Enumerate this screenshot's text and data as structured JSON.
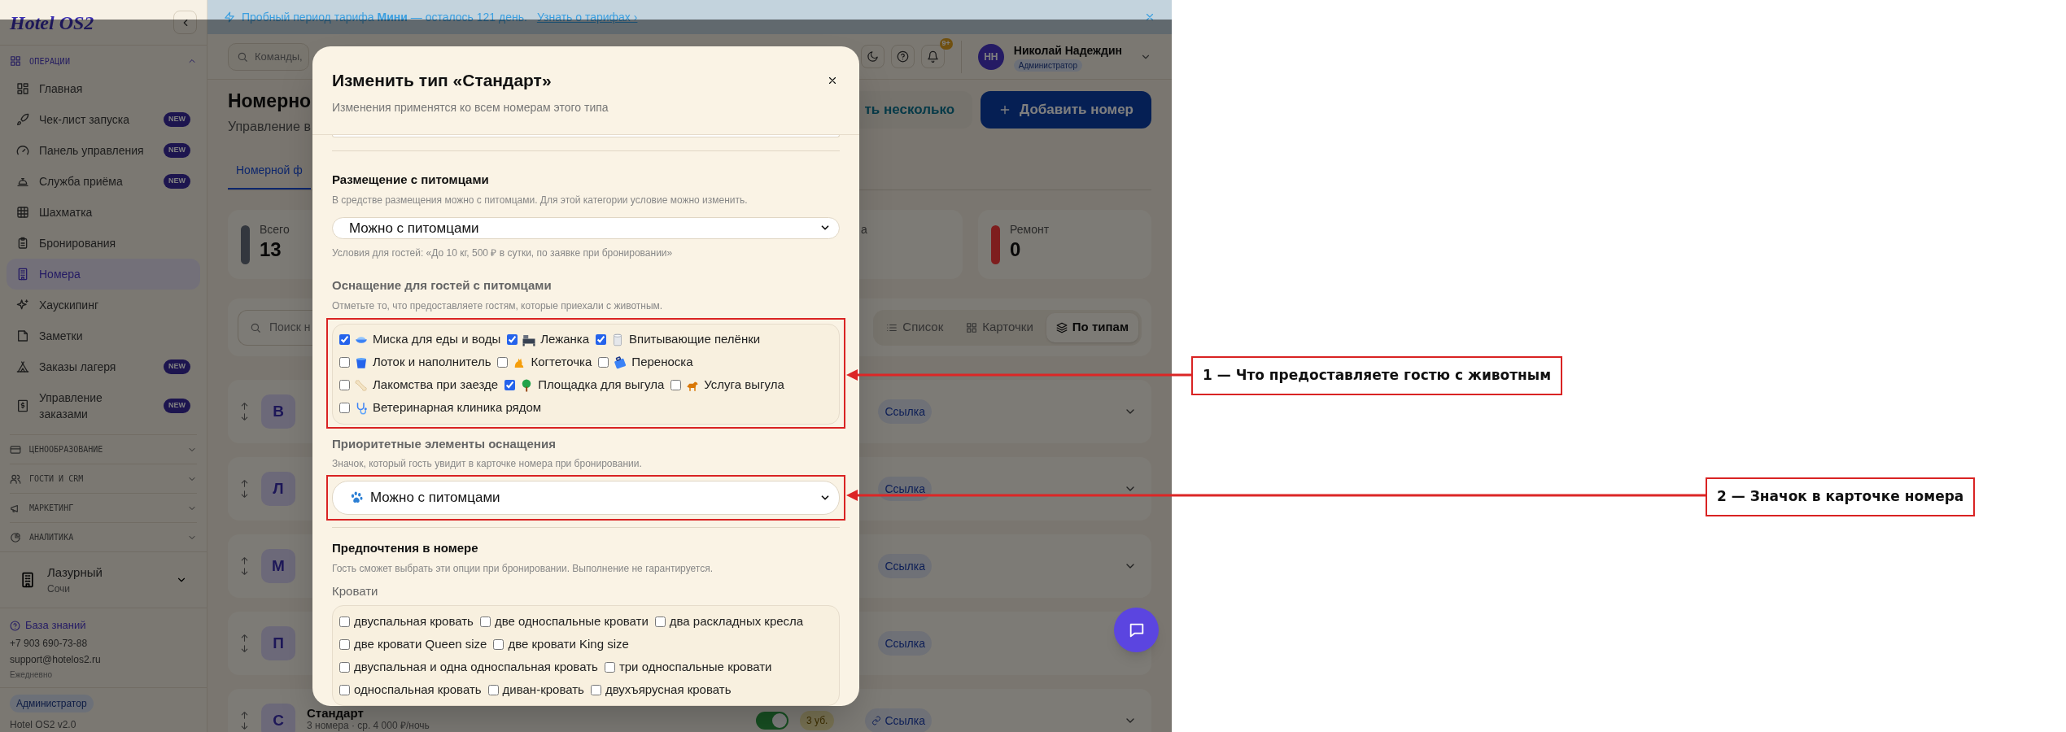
{
  "sidebar": {
    "logo": "Hotel OS2",
    "section": "ОПЕРАЦИИ",
    "items": [
      {
        "label": "Главная",
        "selected": false
      },
      {
        "label": "Чек-лист запуска",
        "badge": "NEW",
        "selected": false
      },
      {
        "label": "Панель управления",
        "badge": "NEW",
        "selected": false
      },
      {
        "label": "Служба приёма",
        "badge": "NEW",
        "selected": false
      },
      {
        "label": "Шахматка",
        "selected": false
      },
      {
        "label": "Бронирования",
        "selected": false
      },
      {
        "label": "Номера",
        "selected": true
      },
      {
        "label": "Хаускипинг",
        "selected": false
      },
      {
        "label": "Заметки",
        "selected": false
      },
      {
        "label": "Заказы лагеря",
        "badge": "NEW",
        "selected": false
      },
      {
        "label": "Управление заказами",
        "badge": "NEW",
        "selected": false
      }
    ],
    "groups": [
      "ЦЕНООБРАЗОВАНИЕ",
      "ГОСТИ И CRM",
      "МАРКЕТИНГ",
      "АНАЛИТИКА"
    ],
    "hotel": {
      "name": "Лазурный",
      "city": "Сочи"
    },
    "support": {
      "link": "База знаний",
      "phone": "+7 903 690-73-88",
      "email": "support@hotelos2.ru",
      "hours": "Ежедневно"
    },
    "role": "Администратор",
    "version": "Hotel OS2 v2.0"
  },
  "banner": {
    "text": "Пробный период тарифа **Мини** — осталось 121 день.",
    "link": "Узнать о тарифах ›"
  },
  "topbar": {
    "search_placeholder": "Команды,",
    "notifications": "9+",
    "user": {
      "initials": "НН",
      "name": "Николай Надеждин",
      "role": "Администратор"
    }
  },
  "page": {
    "title": "Номерно",
    "subtitle": "Управление в",
    "buttons": [
      {
        "label": "ть несколько",
        "kind": "secondary"
      },
      {
        "label": "Добавить номер",
        "kind": "primary"
      }
    ],
    "tabs": [
      {
        "label": "Номерной ф",
        "selected": true
      }
    ],
    "stats": [
      {
        "label": "Всего",
        "value": "13",
        "color": "#33373e"
      },
      {
        "label": "а"
      },
      {
        "label": "Ремонт",
        "value": "0",
        "color": "#7e1e1e"
      }
    ],
    "search_placeholder": "Поиск н",
    "views": [
      {
        "label": "Список",
        "selected": false
      },
      {
        "label": "Карточки",
        "selected": false
      },
      {
        "label": "По типам",
        "selected": true
      }
    ],
    "room_types": [
      {
        "letter": "В",
        "link": "Ссылка"
      },
      {
        "letter": "Л",
        "link": "Ссылка"
      },
      {
        "letter": "М",
        "link": "Ссылка"
      },
      {
        "letter": "П",
        "link": "Ссылка"
      },
      {
        "letter": "С",
        "name": "Стандарт",
        "summary": "3 номера · ср. 4 000 ₽/ночь",
        "on": true,
        "staff": "3 уб.",
        "link": "Ссылка"
      }
    ]
  },
  "modal": {
    "title": "Изменить тип «Стандарт»",
    "subtitle": "Изменения применятся ко всем номерам этого типа",
    "pets": {
      "title": "Размещение с питомцами",
      "hint": "В средстве размещения можно с питомцами. Для этой категории условие можно изменить.",
      "select": "Можно с питомцами",
      "note": "Условия для гостей: «До 10 кг, 500 ₽ в сутки, по заявке при бронировании»"
    },
    "amenities": {
      "title": "Оснащение для гостей с питомцами",
      "hint": "Отметьте то, что предоставляете гостям, которые приехали с животным.",
      "items": [
        {
          "label": "Миска для еды и воды",
          "checked": true
        },
        {
          "label": "Лежанка",
          "checked": true
        },
        {
          "label": "Впитывающие пелёнки",
          "checked": true
        },
        {
          "label": "Лоток и наполнитель",
          "checked": false
        },
        {
          "label": "Когтеточка",
          "checked": false
        },
        {
          "label": "Переноска",
          "checked": false
        },
        {
          "label": "Лакомства при заезде",
          "checked": false
        },
        {
          "label": "Площадка для выгула",
          "checked": true
        },
        {
          "label": "Услуга выгула",
          "checked": false
        },
        {
          "label": "Ветеринарная клиника рядом",
          "checked": false
        }
      ]
    },
    "priority": {
      "title": "Приоритетные элементы оснащения",
      "hint": "Значок, который гость увидит в карточке номера при бронировании.",
      "select": "Можно с питомцами"
    },
    "preferences": {
      "title": "Предпочтения в номере",
      "hint": "Гость сможет выбрать эти опции при бронировании. Выполнение не гарантируется.",
      "group": "Кровати",
      "options": [
        {
          "label": "двуспальная кровать",
          "checked": false
        },
        {
          "label": "две односпальные кровати",
          "checked": false
        },
        {
          "label": "два раскладных кресла",
          "checked": false
        },
        {
          "label": "две кровати Queen size",
          "checked": false
        },
        {
          "label": "две кровати King size",
          "checked": false
        },
        {
          "label": "двуспальная и одна односпальная кровать",
          "checked": false
        },
        {
          "label": "три односпальные кровати",
          "checked": false
        },
        {
          "label": "односпальная кровать",
          "checked": false
        },
        {
          "label": "диван-кровать",
          "checked": false
        },
        {
          "label": "двухъярусная кровать",
          "checked": false
        }
      ]
    }
  },
  "callouts": [
    {
      "text": "1 — Что предоставляете гостю с животным"
    },
    {
      "text": "2 — Значок в карточке номера"
    }
  ]
}
